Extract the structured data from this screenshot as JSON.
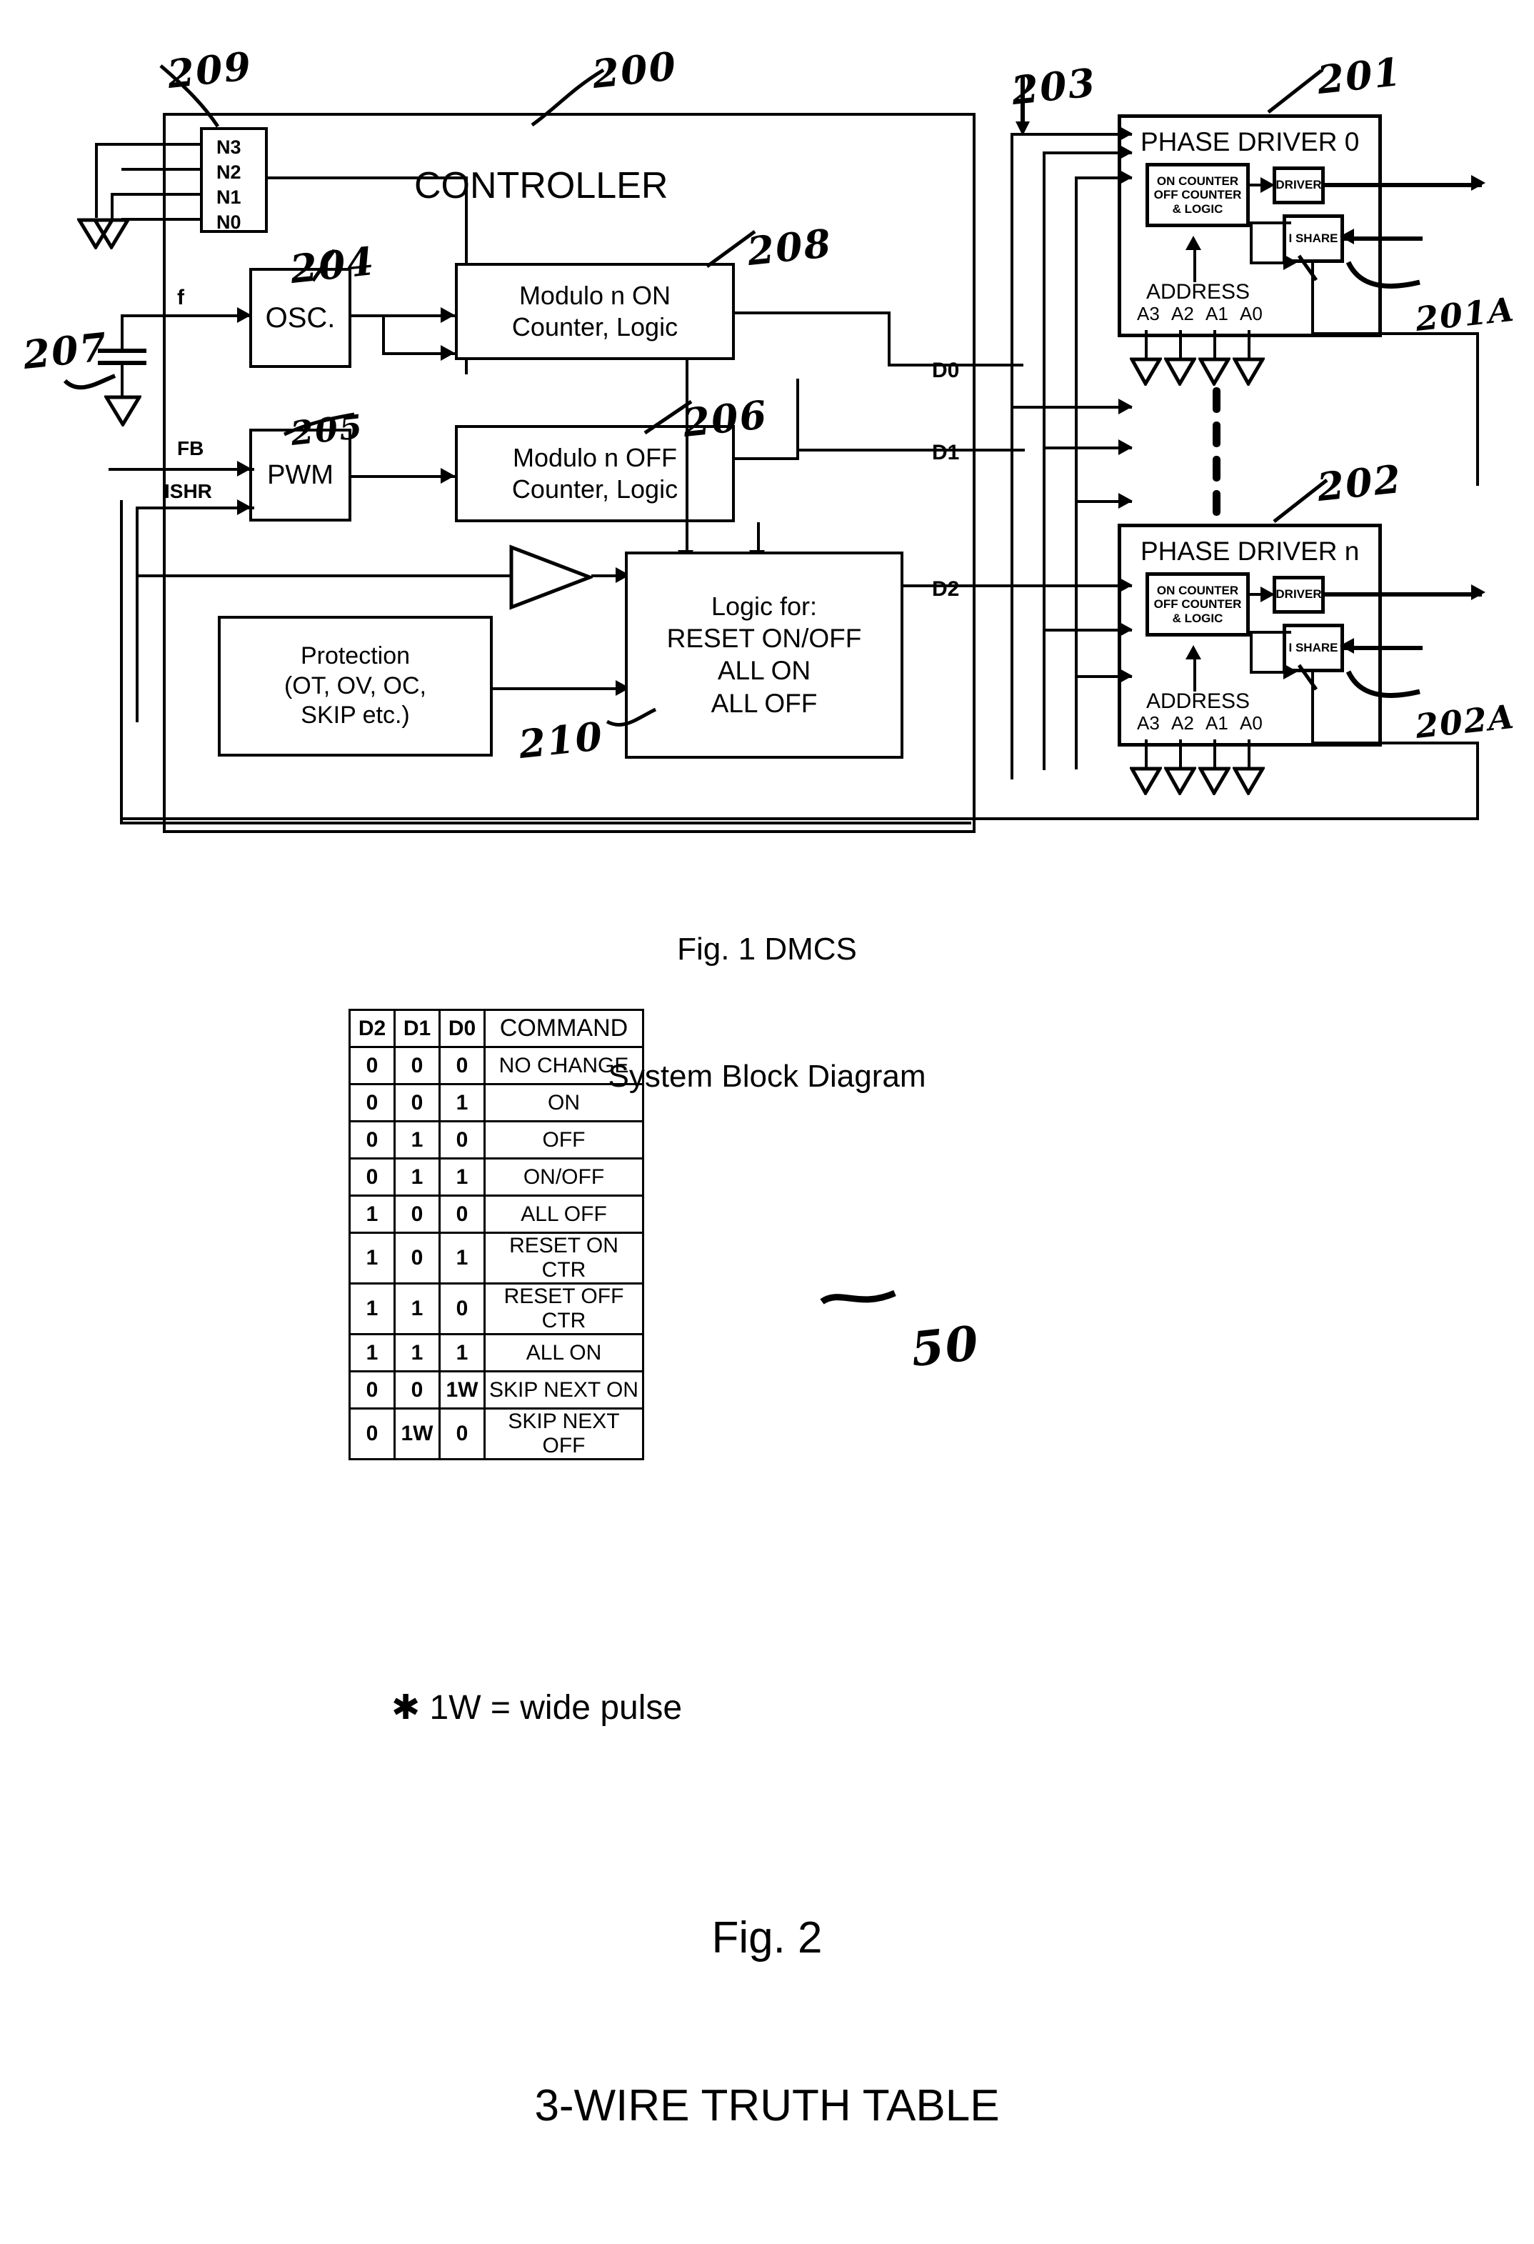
{
  "figure1": {
    "caption_line1": "Fig. 1 DMCS",
    "caption_line2": "System Block Diagram",
    "controller": {
      "title": "CONTROLLER",
      "ref": "200",
      "nbus": {
        "ref": "209",
        "pins": [
          "N3",
          "N2",
          "N1",
          "N0"
        ]
      },
      "osc": {
        "label": "OSC.",
        "ref": "204"
      },
      "pwm": {
        "label": "PWM",
        "ref": "205"
      },
      "mod_on": {
        "line1": "Modulo n ON",
        "line2": "Counter, Logic",
        "ref": "208"
      },
      "mod_off": {
        "line1": "Modulo n OFF",
        "line2": "Counter, Logic",
        "ref": "206"
      },
      "protection": {
        "line1": "Protection",
        "line2": "(OT, OV, OC,",
        "line3": "SKIP etc.)"
      },
      "logic": {
        "line1": "Logic for:",
        "line2": "RESET ON/OFF",
        "line3": "ALL ON",
        "line4": "ALL OFF",
        "ref": "210"
      },
      "inputs": {
        "f": "f",
        "fb": "FB",
        "ishr": "ISHR"
      },
      "cap_ref": "207"
    },
    "bus": {
      "ref": "203",
      "signals": [
        "D0",
        "D1",
        "D2"
      ]
    },
    "phase_driver_0": {
      "title": "PHASE DRIVER 0",
      "ref": "201",
      "counter_line1": "ON COUNTER",
      "counter_line2": "OFF COUNTER",
      "counter_line3": "& LOGIC",
      "driver": "DRIVER",
      "ishare": "I SHARE",
      "ishare_ref": "201A",
      "address_label": "ADDRESS",
      "address_pins": [
        "A3",
        "A2",
        "A1",
        "A0"
      ]
    },
    "phase_driver_n": {
      "title": "PHASE DRIVER n",
      "ref": "202",
      "counter_line1": "ON COUNTER",
      "counter_line2": "OFF COUNTER",
      "counter_line3": "& LOGIC",
      "driver": "DRIVER",
      "ishare": "I SHARE",
      "ishare_ref": "202A",
      "address_label": "ADDRESS",
      "address_pins": [
        "A3",
        "A2",
        "A1",
        "A0"
      ]
    }
  },
  "figure2": {
    "caption_line1": "Fig. 2",
    "caption_line2": "3-WIRE TRUTH TABLE",
    "ref": "50",
    "footnote": "✱ 1W = wide pulse",
    "table": {
      "headers": [
        "D2",
        "D1",
        "D0",
        "COMMAND"
      ],
      "rows": [
        [
          "0",
          "0",
          "0",
          "NO CHANGE"
        ],
        [
          "0",
          "0",
          "1",
          "ON"
        ],
        [
          "0",
          "1",
          "0",
          "OFF"
        ],
        [
          "0",
          "1",
          "1",
          "ON/OFF"
        ],
        [
          "1",
          "0",
          "0",
          "ALL OFF"
        ],
        [
          "1",
          "0",
          "1",
          "RESET ON CTR"
        ],
        [
          "1",
          "1",
          "0",
          "RESET OFF CTR"
        ],
        [
          "1",
          "1",
          "1",
          "ALL ON"
        ],
        [
          "0",
          "0",
          "1W",
          "SKIP NEXT ON"
        ],
        [
          "0",
          "1W",
          "0",
          "SKIP NEXT OFF"
        ]
      ]
    }
  }
}
